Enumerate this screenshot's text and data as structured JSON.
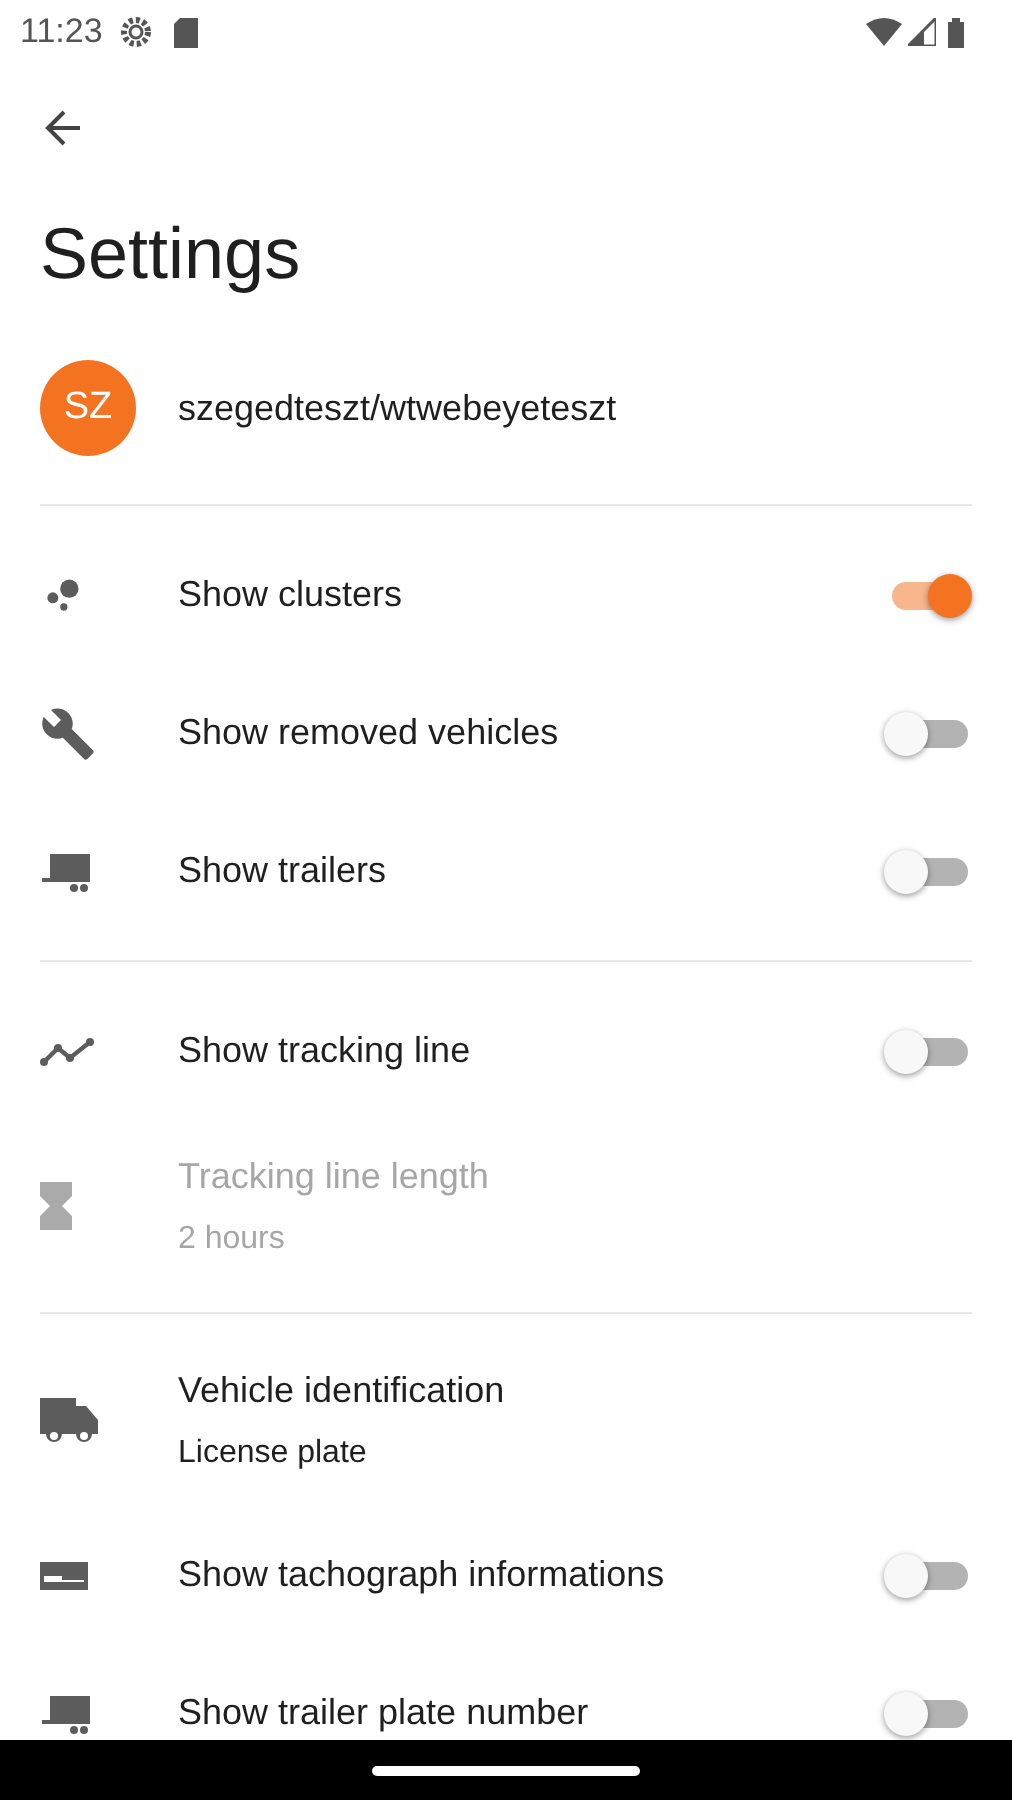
{
  "status_bar": {
    "time": "11:23"
  },
  "title": "Settings",
  "account": {
    "initials": "SZ",
    "name": "szegedteszt/wtwebeyeteszt"
  },
  "sections": [
    {
      "items": [
        {
          "kind": "toggle",
          "label": "Show clusters",
          "on": true,
          "disabled": false
        },
        {
          "kind": "toggle",
          "label": "Show removed vehicles",
          "on": false,
          "disabled": false
        },
        {
          "kind": "toggle",
          "label": "Show trailers",
          "on": false,
          "disabled": false
        }
      ]
    },
    {
      "items": [
        {
          "kind": "toggle",
          "label": "Show tracking line",
          "on": false,
          "disabled": false
        },
        {
          "kind": "value",
          "label": "Tracking line length",
          "value": "2 hours",
          "disabled": true
        }
      ]
    },
    {
      "items": [
        {
          "kind": "value",
          "label": "Vehicle identification",
          "value": "License plate",
          "disabled": false
        },
        {
          "kind": "toggle",
          "label": "Show tachograph informations",
          "on": false,
          "disabled": false
        },
        {
          "kind": "toggle",
          "label": "Show trailer plate number",
          "on": false,
          "disabled": false
        }
      ]
    }
  ]
}
